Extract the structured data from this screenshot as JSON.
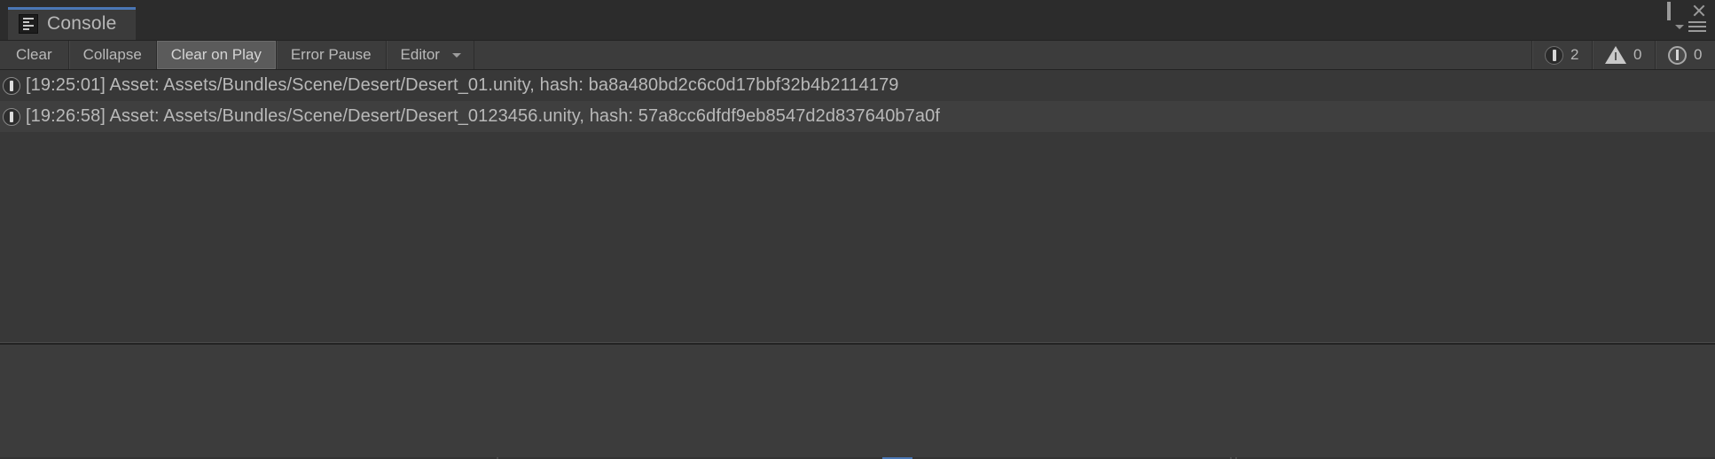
{
  "window": {
    "tab_label": "Console",
    "tab_icon": "console-list-icon",
    "controls": {
      "maximize": "maximize-icon",
      "close": "close-icon",
      "menu": "hamburger-menu-icon",
      "menu_caret": "chevron-down-icon"
    }
  },
  "toolbar": {
    "clear_label": "Clear",
    "collapse_label": "Collapse",
    "clear_on_play_label": "Clear on Play",
    "error_pause_label": "Error Pause",
    "editor_label": "Editor",
    "editor_caret": "chevron-down-icon",
    "counters": [
      {
        "icon": "error-icon",
        "count": "2"
      },
      {
        "icon": "warning-icon",
        "count": "0"
      },
      {
        "icon": "info-icon",
        "count": "0"
      }
    ]
  },
  "log": {
    "entries": [
      {
        "icon": "error-icon",
        "text": "[19:25:01] Asset: Assets/Bundles/Scene/Desert/Desert_01.unity, hash: ba8a480bd2c6c0d17bbf32b4b2114179"
      },
      {
        "icon": "error-icon",
        "text": "[19:26:58] Asset: Assets/Bundles/Scene/Desert/Desert_0123456.unity, hash: 57a8cc6dfdf9eb8547d2d837640b7a0f"
      }
    ]
  },
  "detail": {
    "content": ""
  },
  "colors": {
    "window_bg": "#383838",
    "toolbar_bg": "#3c3c3c",
    "tabbar_bg": "#2c2c2c",
    "tab_bg": "#3b3b3b",
    "tab_accent": "#4a77b5",
    "row_odd": "#383838",
    "row_even": "#3f3f3f",
    "text": "#b9b9b9",
    "active_button": "#5b5b5b",
    "divider": "#232323"
  }
}
